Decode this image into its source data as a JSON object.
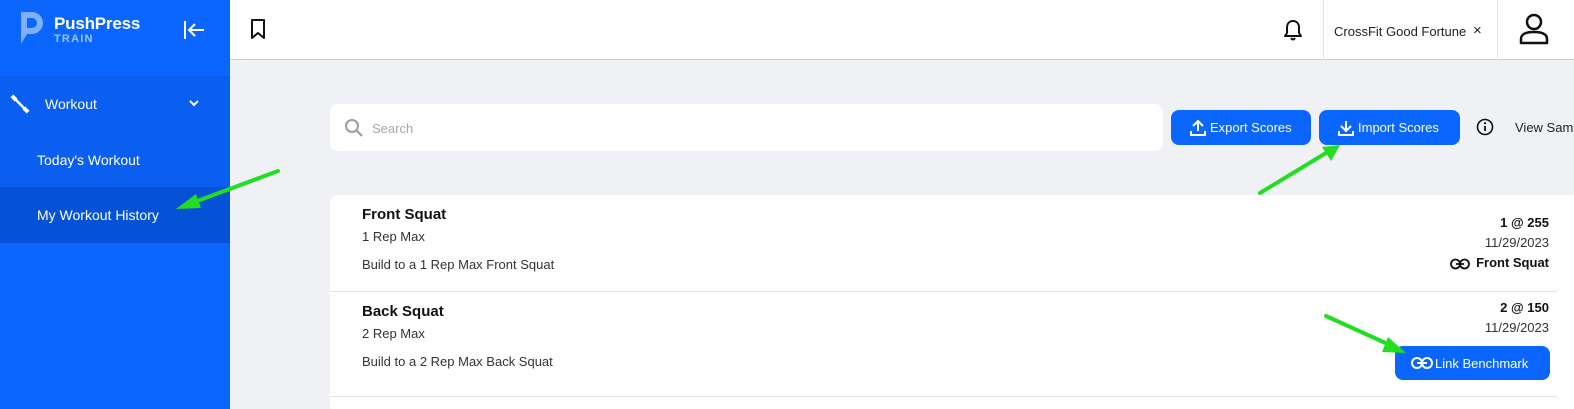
{
  "brand": {
    "name": "PushPress",
    "product": "TRAIN"
  },
  "sidebar": {
    "group_label": "Workout",
    "items": [
      {
        "label": "Today's Workout"
      },
      {
        "label": "My Workout History"
      }
    ]
  },
  "topbar": {
    "gym_name": "CrossFit Good Fortune",
    "gym_close": "×"
  },
  "toolbar": {
    "search_placeholder": "Search",
    "export_label": "Export Scores",
    "import_label": "Import Scores",
    "view_sample_label": "View Sam"
  },
  "workouts": [
    {
      "title": "Front Squat",
      "subtitle": "1 Rep Max",
      "description": "Build to a 1 Rep Max Front Squat",
      "score": "1 @ 255",
      "date": "11/29/2023",
      "benchmark": "Front Squat"
    },
    {
      "title": "Back Squat",
      "subtitle": "2 Rep Max",
      "description": "Build to a 2 Rep Max Back Squat",
      "score": "2 @ 150",
      "date": "11/29/2023",
      "link_label": "Link Benchmark"
    }
  ],
  "colors": {
    "primary": "#0a66ff",
    "annotation_arrow": "#22dd22"
  },
  "icons": [
    "pushpress-logo-icon",
    "collapse-sidebar-icon",
    "workout-icon",
    "chevron-down-icon",
    "bookmark-icon",
    "bell-icon",
    "user-icon",
    "search-icon",
    "upload-icon",
    "download-icon",
    "info-icon",
    "link-icon"
  ]
}
